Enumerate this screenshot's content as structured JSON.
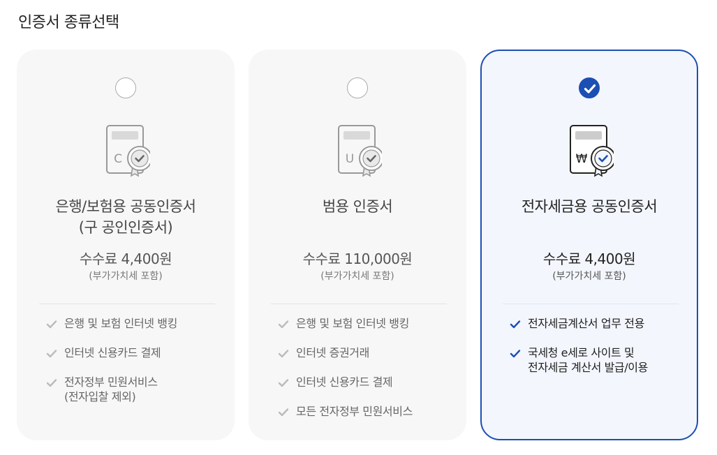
{
  "page": {
    "title": "인증서 종류선택"
  },
  "cards": [
    {
      "title_lines": [
        "은행/보험용 공동인증서",
        "(구 공인인증서)"
      ],
      "icon_letter": "C",
      "fee": "수수료 4,400원",
      "vat": "(부가가치세 포함)",
      "selected": false,
      "features": [
        {
          "lines": [
            "은행 및 보험 인터넷 뱅킹"
          ]
        },
        {
          "lines": [
            "인터넷 신용카드 결제"
          ]
        },
        {
          "lines": [
            "전자정부 민원서비스",
            "(전자입찰 제외)"
          ]
        }
      ]
    },
    {
      "title_lines": [
        "범용 인증서"
      ],
      "icon_letter": "U",
      "fee": "수수료 110,000원",
      "vat": "(부가가치세 포함)",
      "selected": false,
      "features": [
        {
          "lines": [
            "은행 및 보험 인터넷 뱅킹"
          ]
        },
        {
          "lines": [
            "인터넷 증권거래"
          ]
        },
        {
          "lines": [
            "인터넷 신용카드 결제"
          ]
        },
        {
          "lines": [
            "모든 전자정부 민원서비스"
          ]
        }
      ]
    },
    {
      "title_lines": [
        "전자세금용 공동인증서"
      ],
      "icon_letter": "₩",
      "fee": "수수료 4,400원",
      "vat": "(부가가치세 포함)",
      "selected": true,
      "features": [
        {
          "lines": [
            "전자세금계산서 업무 전용"
          ]
        },
        {
          "lines": [
            "국세청 e세로 사이트 및",
            "전자세금 계산서 발급/이용"
          ]
        }
      ]
    }
  ],
  "colors": {
    "accent": "#1c4fb3",
    "card_bg": "#f7f7f7",
    "selected_bg": "#f3f6fd",
    "muted_check": "#bbbbbb"
  },
  "icons": {
    "radio_checked": "check-circle-icon",
    "certificate": "certificate-icon",
    "feature": "checkmark-icon"
  }
}
